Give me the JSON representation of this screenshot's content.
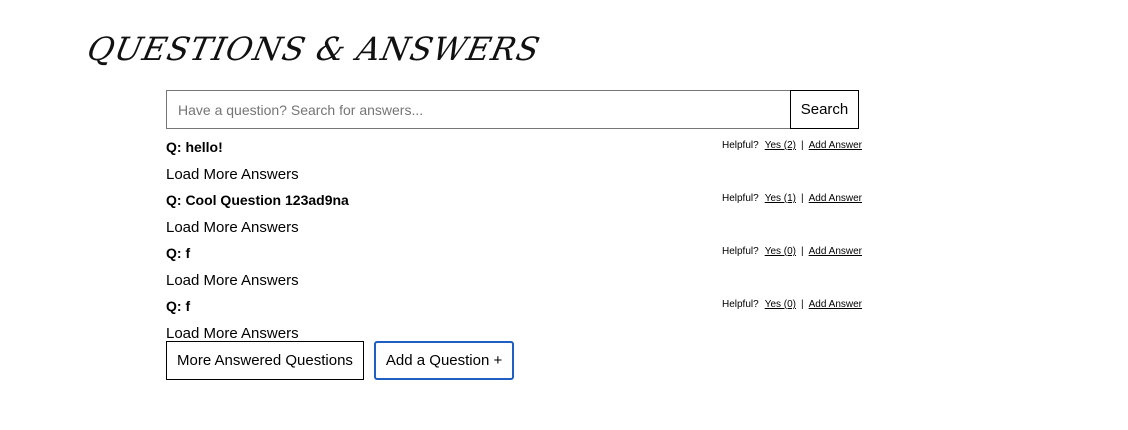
{
  "header": {
    "title": "QUESTIONS & ANSWERS"
  },
  "search": {
    "placeholder": "Have a question? Search for answers...",
    "value": "",
    "button_label": "Search"
  },
  "questions": [
    {
      "text": "Q: hello!",
      "helpful_label": "Helpful?",
      "yes_label": "Yes (2)",
      "separator": "|",
      "add_answer_label": "Add Answer",
      "load_more_label": "Load More Answers"
    },
    {
      "text": "Q: Cool Question 123ad9na",
      "helpful_label": "Helpful?",
      "yes_label": "Yes (1)",
      "separator": "|",
      "add_answer_label": "Add Answer",
      "load_more_label": "Load More Answers"
    },
    {
      "text": "Q: f",
      "helpful_label": "Helpful?",
      "yes_label": "Yes (0)",
      "separator": "|",
      "add_answer_label": "Add Answer",
      "load_more_label": "Load More Answers"
    },
    {
      "text": "Q: f",
      "helpful_label": "Helpful?",
      "yes_label": "Yes (0)",
      "separator": "|",
      "add_answer_label": "Add Answer",
      "load_more_label": "Load More Answers"
    }
  ],
  "actions": {
    "more_questions_label": "More Answered Questions",
    "add_question_label": "Add a Question +"
  },
  "colors": {
    "add_question_border": "#1f5fc4"
  }
}
